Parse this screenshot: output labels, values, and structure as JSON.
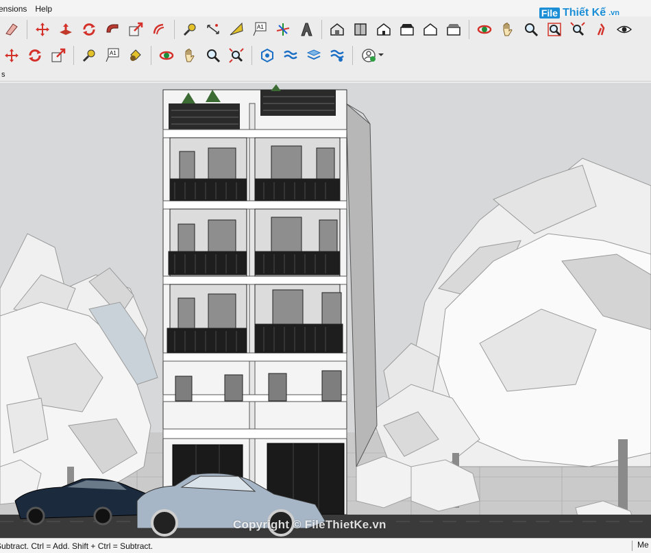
{
  "menubar": {
    "items": [
      "ensions",
      "Help"
    ]
  },
  "toolbar_top": {
    "icons": [
      "eraser-icon",
      "move-icon",
      "push-pull-icon",
      "rotate-icon",
      "follow-me-icon",
      "scale-icon",
      "offset-icon",
      "tape-measure-icon",
      "dimension-icon",
      "protractor-icon",
      "text-icon",
      "axes-icon",
      "3d-text-icon",
      "iso-view-icon",
      "top-view-icon",
      "front-view-icon",
      "right-view-icon",
      "back-view-icon",
      "left-view-icon",
      "orbit-icon",
      "pan-icon",
      "zoom-icon",
      "zoom-window-icon",
      "zoom-extents-icon",
      "walk-icon",
      "look-around-icon"
    ]
  },
  "toolbar_bottom": {
    "icons": [
      "move-icon",
      "rotate-icon",
      "scale-icon",
      "tape-measure-icon",
      "text-icon",
      "paint-bucket-icon",
      "orbit-icon",
      "pan-icon",
      "zoom-icon",
      "zoom-extents-icon",
      "outer-shell-icon",
      "intersect-icon",
      "union-icon",
      "subtract-icon",
      "profile-icon"
    ]
  },
  "brand": {
    "logo": "File",
    "name": "Thiết Kế",
    "domain": ".vn"
  },
  "tabs": {
    "scene": "s"
  },
  "watermark": "Copyright © FileThietKe.vn",
  "status": {
    "hint": "Subtract. Ctrl = Add. Shift + Ctrl = Subtract.",
    "measurements_label": "Me"
  },
  "colors": {
    "accent_red": "#d4312a",
    "accent_blue": "#1b8ed6",
    "sky": "#d6d8d9"
  }
}
